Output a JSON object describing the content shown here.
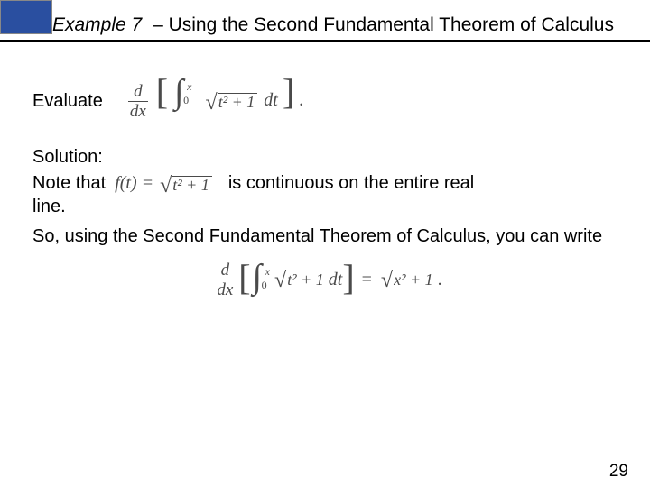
{
  "header": {
    "example_label": "Example 7",
    "separator": "–",
    "title_rest": "Using the Second Fundamental Theorem of Calculus"
  },
  "evaluate": {
    "word": "Evaluate",
    "frac_num": "d",
    "frac_den": "dx",
    "int_upper": "x",
    "int_lower": "0",
    "radicand": "t² + 1",
    "after_sqrt": " dt",
    "close_punct": "."
  },
  "solution": {
    "heading": "Solution:",
    "note_that": "Note that",
    "ft_lhs": "f(t) = ",
    "ft_radicand": "t² + 1",
    "cont_text": " is continuous on the entire real",
    "line_word": "line.",
    "so_text": "So, using the Second Fundamental Theorem of Calculus, you can write"
  },
  "result": {
    "frac_num": "d",
    "frac_den": "dx",
    "int_upper": "x",
    "int_lower": "0",
    "radicand_left": "t² + 1",
    "after_sqrt_left": " dt",
    "equals": "=",
    "radicand_right": "x² + 1",
    "close_punct": "."
  },
  "page_number": "29"
}
